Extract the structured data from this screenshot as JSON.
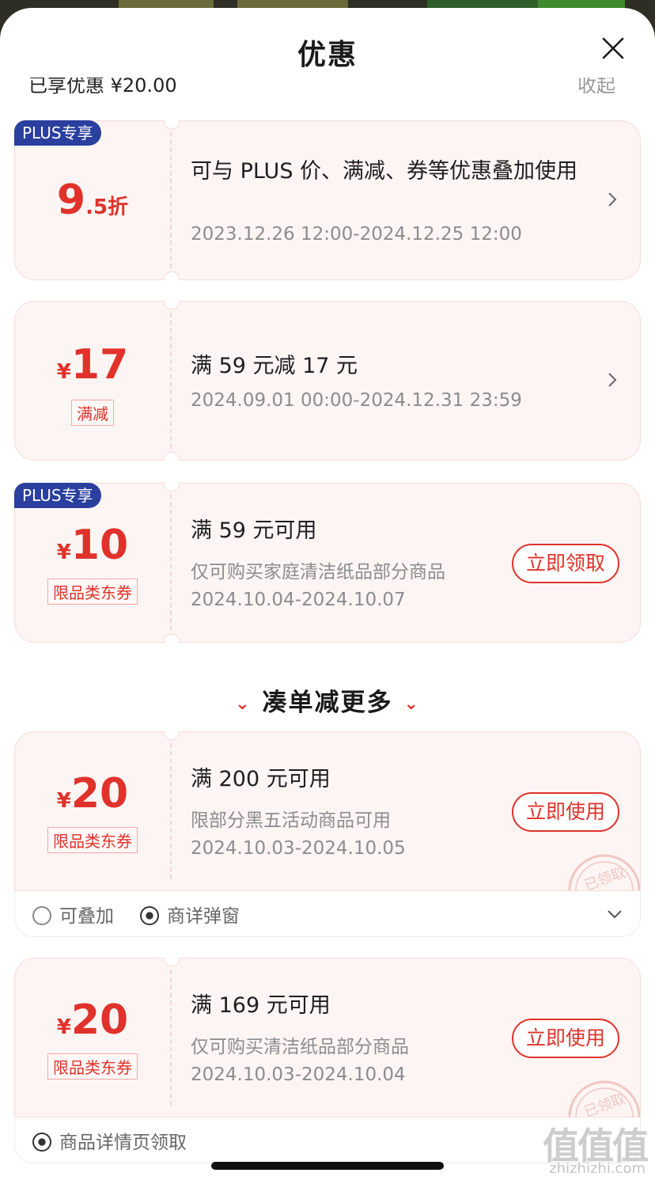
{
  "sheet": {
    "title": "优惠"
  },
  "cut_row": {
    "left": "已享优惠 ¥20.00",
    "right": "收起"
  },
  "cards": [
    {
      "badge": "PLUS专享",
      "amount_big": "9",
      "amount_small": ".5折",
      "title": "可与 PLUS 价、满减、券等优惠叠加使用",
      "date": "2023.12.26 12:00-2024.12.25 12:00"
    },
    {
      "currency": "¥",
      "amount_big": "17",
      "tag": "满减",
      "title": "满 59 元减 17 元",
      "date": "2024.09.01 00:00-2024.12.31 23:59"
    },
    {
      "badge": "PLUS专享",
      "currency": "¥",
      "amount_big": "10",
      "tag": "限品类东券",
      "title": "满 59 元可用",
      "desc": "仅可购买家庭清洁纸品部分商品",
      "date": "2024.10.04-2024.10.07",
      "action": "立即领取"
    }
  ],
  "section": {
    "title": "凑单减更多"
  },
  "more_cards": [
    {
      "currency": "¥",
      "amount_big": "20",
      "tag": "限品类东券",
      "title": "满 200 元可用",
      "desc": "限部分黑五活动商品可用",
      "date": "2024.10.03-2024.10.05",
      "action": "立即使用",
      "stamp": "已领取",
      "footer": [
        "可叠加",
        "商详弹窗"
      ]
    },
    {
      "currency": "¥",
      "amount_big": "20",
      "tag": "限品类东券",
      "title": "满 169 元可用",
      "desc": "仅可购买清洁纸品部分商品",
      "date": "2024.10.03-2024.10.04",
      "action": "立即使用",
      "stamp": "已领取",
      "footer": [
        "商品详情页领取"
      ]
    }
  ],
  "watermark": {
    "text": "值值值",
    "sub": "zhizhizhi.com"
  },
  "colors": {
    "accent": "#e0322b",
    "plus_badge": "#2a3f9e",
    "card_bg": "#fdf5f4"
  },
  "icons": [
    "close-icon",
    "chevron-right-icon",
    "chevron-down-icon",
    "stack-icon",
    "popup-icon",
    "stamp-icon"
  ]
}
